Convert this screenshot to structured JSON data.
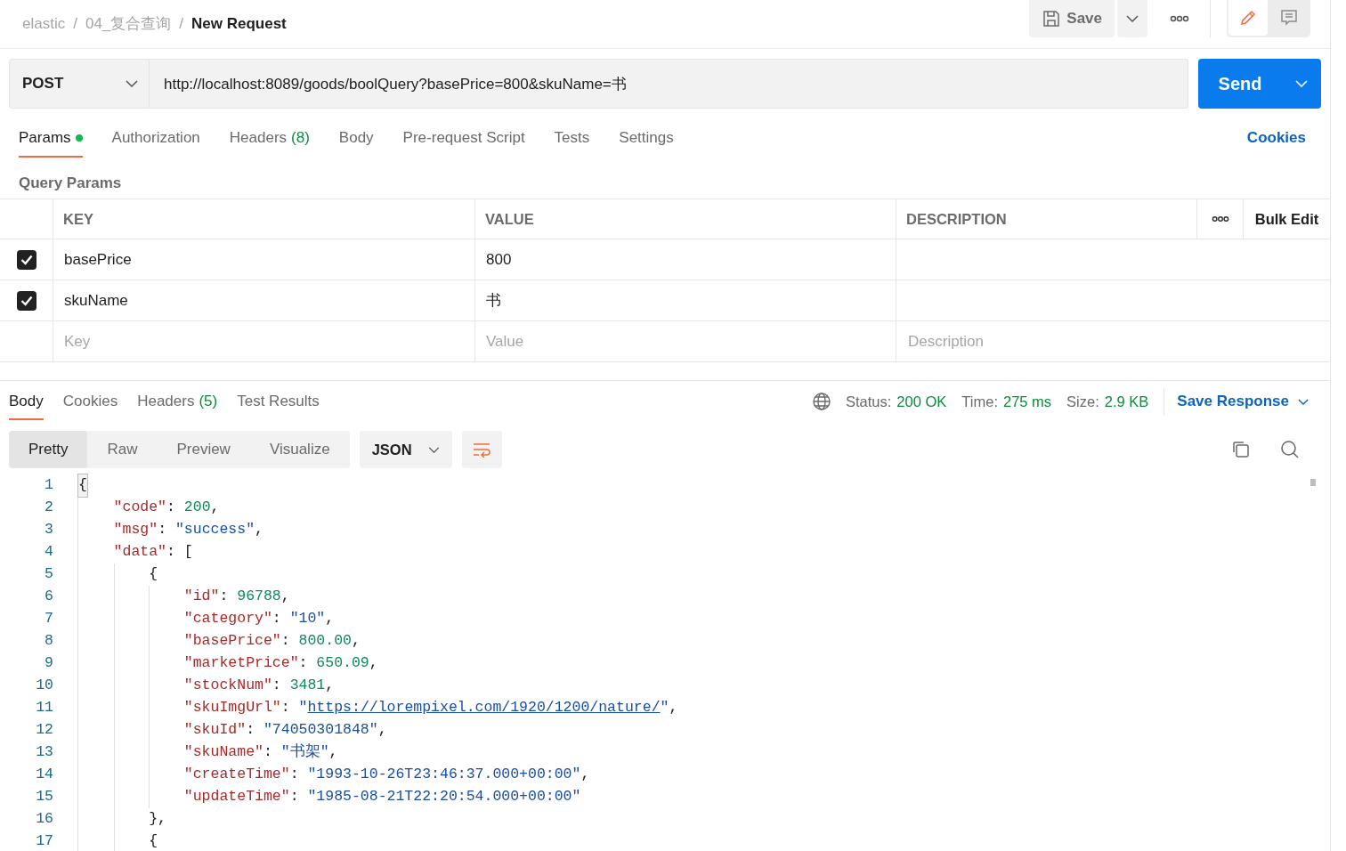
{
  "breadcrumb": [
    {
      "text": "elastic",
      "current": false
    },
    {
      "text": "04_复合查询",
      "current": false
    },
    {
      "text": "New Request",
      "current": true
    }
  ],
  "breadcrumb_separator": "/",
  "toolbar": {
    "save": "Save",
    "mode_tabs": [
      {
        "kind": "edit",
        "selected": true
      },
      {
        "kind": "comment",
        "selected": false
      }
    ]
  },
  "request": {
    "method": "POST",
    "url": "http://localhost:8089/goods/boolQuery?basePrice=800&skuName=书",
    "send": "Send"
  },
  "request_tabs": [
    {
      "label": "Params",
      "dot": true,
      "selected": true
    },
    {
      "label": "Authorization",
      "dot": false,
      "selected": false
    },
    {
      "label": "Headers",
      "count": "(8)",
      "dot": false,
      "selected": false
    },
    {
      "label": "Body",
      "dot": false,
      "selected": false
    },
    {
      "label": "Pre-request Script",
      "dot": false,
      "selected": false
    },
    {
      "label": "Tests",
      "dot": false,
      "selected": false
    },
    {
      "label": "Settings",
      "dot": false,
      "selected": false
    }
  ],
  "cookies_link": "Cookies",
  "query_params": {
    "title": "Query Params",
    "columns": [
      "KEY",
      "VALUE",
      "DESCRIPTION"
    ],
    "bulk_edit": "Bulk Edit",
    "rows": [
      {
        "checked": true,
        "key": "basePrice",
        "value": "800"
      },
      {
        "checked": true,
        "key": "skuName",
        "value": "书"
      }
    ],
    "empty_row": [
      {
        "placeholder": "Key"
      },
      {
        "placeholder": "Value"
      },
      {
        "placeholder": "Description"
      }
    ]
  },
  "response_tabs": [
    {
      "label": "Body",
      "selected": true
    },
    {
      "label": "Cookies",
      "selected": false
    },
    {
      "label": "Headers",
      "count": "(5)",
      "selected": false
    },
    {
      "label": "Test Results",
      "selected": false
    }
  ],
  "response_meta": [
    {
      "label": "Status:",
      "value": "200 OK"
    },
    {
      "label": "Time:",
      "value": "275 ms"
    },
    {
      "label": "Size:",
      "value": "2.9 KB"
    }
  ],
  "save_response": "Save Response",
  "view_tabs": [
    {
      "label": "Pretty",
      "selected": true
    },
    {
      "label": "Raw",
      "selected": false
    },
    {
      "label": "Preview",
      "selected": false
    },
    {
      "label": "Visualize",
      "selected": false
    }
  ],
  "format": "JSON",
  "code_lines": [
    {
      "number": "1",
      "tokens": [
        {
          "kind": "match",
          "text": "{"
        }
      ]
    },
    {
      "number": "2",
      "tokens": [
        {
          "kind": "key",
          "text": "    \"code\""
        },
        {
          "kind": "punct",
          "text": ": "
        },
        {
          "kind": "number",
          "text": "200"
        },
        {
          "kind": "punct",
          "text": ","
        }
      ]
    },
    {
      "number": "3",
      "tokens": [
        {
          "kind": "key",
          "text": "    \"msg\""
        },
        {
          "kind": "punct",
          "text": ": "
        },
        {
          "kind": "string",
          "text": "\"success\""
        },
        {
          "kind": "punct",
          "text": ","
        }
      ]
    },
    {
      "number": "4",
      "tokens": [
        {
          "kind": "key",
          "text": "    \"data\""
        },
        {
          "kind": "punct",
          "text": ": ["
        }
      ]
    },
    {
      "number": "5",
      "tokens": [
        {
          "kind": "punct",
          "text": "        {"
        }
      ]
    },
    {
      "number": "6",
      "tokens": [
        {
          "kind": "key",
          "text": "            \"id\""
        },
        {
          "kind": "punct",
          "text": ": "
        },
        {
          "kind": "number",
          "text": "96788"
        },
        {
          "kind": "punct",
          "text": ","
        }
      ]
    },
    {
      "number": "7",
      "tokens": [
        {
          "kind": "key",
          "text": "            \"category\""
        },
        {
          "kind": "punct",
          "text": ": "
        },
        {
          "kind": "string",
          "text": "\"10\""
        },
        {
          "kind": "punct",
          "text": ","
        }
      ]
    },
    {
      "number": "8",
      "tokens": [
        {
          "kind": "key",
          "text": "            \"basePrice\""
        },
        {
          "kind": "punct",
          "text": ": "
        },
        {
          "kind": "number",
          "text": "800.00"
        },
        {
          "kind": "punct",
          "text": ","
        }
      ]
    },
    {
      "number": "9",
      "tokens": [
        {
          "kind": "key",
          "text": "            \"marketPrice\""
        },
        {
          "kind": "punct",
          "text": ": "
        },
        {
          "kind": "number",
          "text": "650.09"
        },
        {
          "kind": "punct",
          "text": ","
        }
      ]
    },
    {
      "number": "10",
      "tokens": [
        {
          "kind": "key",
          "text": "            \"stockNum\""
        },
        {
          "kind": "punct",
          "text": ": "
        },
        {
          "kind": "number",
          "text": "3481"
        },
        {
          "kind": "punct",
          "text": ","
        }
      ]
    },
    {
      "number": "11",
      "tokens": [
        {
          "kind": "key",
          "text": "            \"skuImgUrl\""
        },
        {
          "kind": "punct",
          "text": ": "
        },
        {
          "kind": "string",
          "text": "\""
        },
        {
          "kind": "link",
          "text": "https://lorempixel.com/1920/1200/nature/"
        },
        {
          "kind": "string",
          "text": "\""
        },
        {
          "kind": "punct",
          "text": ","
        }
      ]
    },
    {
      "number": "12",
      "tokens": [
        {
          "kind": "key",
          "text": "            \"skuId\""
        },
        {
          "kind": "punct",
          "text": ": "
        },
        {
          "kind": "string",
          "text": "\"74050301848\""
        },
        {
          "kind": "punct",
          "text": ","
        }
      ]
    },
    {
      "number": "13",
      "tokens": [
        {
          "kind": "key",
          "text": "            \"skuName\""
        },
        {
          "kind": "punct",
          "text": ": "
        },
        {
          "kind": "string",
          "text": "\"书架\""
        },
        {
          "kind": "punct",
          "text": ","
        }
      ]
    },
    {
      "number": "14",
      "tokens": [
        {
          "kind": "key",
          "text": "            \"createTime\""
        },
        {
          "kind": "punct",
          "text": ": "
        },
        {
          "kind": "string",
          "text": "\"1993-10-26T23:46:37.000+00:00\""
        },
        {
          "kind": "punct",
          "text": ","
        }
      ]
    },
    {
      "number": "15",
      "tokens": [
        {
          "kind": "key",
          "text": "            \"updateTime\""
        },
        {
          "kind": "punct",
          "text": ": "
        },
        {
          "kind": "string",
          "text": "\"1985-08-21T22:20:54.000+00:00\""
        }
      ]
    },
    {
      "number": "16",
      "tokens": [
        {
          "kind": "punct",
          "text": "        },"
        }
      ]
    },
    {
      "number": "17",
      "tokens": [
        {
          "kind": "punct",
          "text": "        {"
        }
      ]
    }
  ]
}
